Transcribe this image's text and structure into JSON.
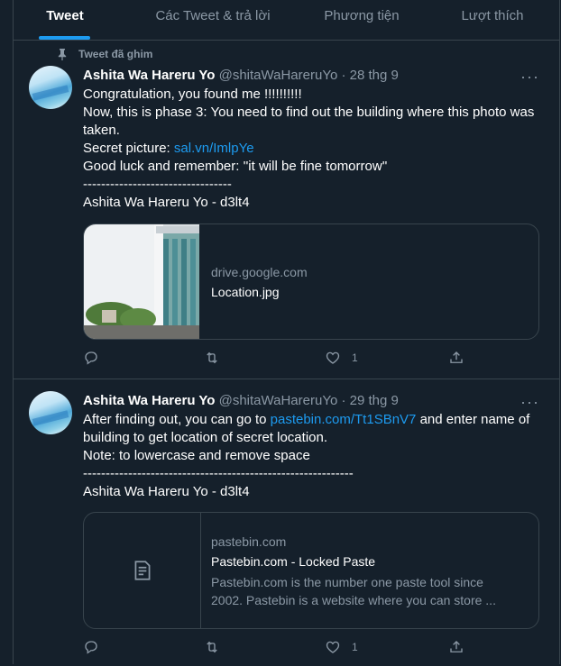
{
  "tabs": [
    {
      "label": "Tweet",
      "active": true
    },
    {
      "label": "Các Tweet & trả lời",
      "active": false
    },
    {
      "label": "Phương tiện",
      "active": false
    },
    {
      "label": "Lượt thích",
      "active": false
    }
  ],
  "tweet1": {
    "pinned_label": "Tweet đã ghim",
    "display_name": "Ashita Wa Hareru Yo",
    "handle": "@shitaWaHareruYo",
    "separator": " · ",
    "date": "28 thg 9",
    "more": "···",
    "text": {
      "line1": "Congratulation, you found me !!!!!!!!!!",
      "line2": "Now, this is phase 3: You need to find out the building where this photo was taken.",
      "line3_prefix": "Secret picture: ",
      "line3_link": "sal.vn/ImlpYe",
      "line4": "Good luck and remember: ''it will be fine tomorrow''",
      "line5": "---------------------------------",
      "line6": "Ashita Wa Hareru Yo - d3lt4"
    },
    "card": {
      "domain": "drive.google.com",
      "title": "Location.jpg"
    },
    "actions": {
      "reply": "",
      "retweet": "",
      "like": "1",
      "share": ""
    }
  },
  "tweet2": {
    "display_name": "Ashita Wa Hareru Yo",
    "handle": "@shitaWaHareruYo",
    "separator": " · ",
    "date": "29 thg 9",
    "more": "···",
    "text": {
      "line1_prefix": "After finding out, you can go to ",
      "line1_link": "pastebin.com/Tt1SBnV7",
      "line1_suffix": " and enter name of building to get location of secret location.",
      "line2": "Note: to lowercase and remove space",
      "line3": "------------------------------------------------------------",
      "line4": "Ashita Wa Hareru Yo - d3lt4"
    },
    "card": {
      "domain": "pastebin.com",
      "title": "Pastebin.com - Locked Paste",
      "desc_line1": "Pastebin.com is the number one paste tool since",
      "desc_line2": "2002. Pastebin is a website where you can store ..."
    },
    "actions": {
      "reply": "",
      "retweet": "",
      "like": "1",
      "share": ""
    }
  },
  "colors": {
    "background": "#15202b",
    "accent": "#1d9bf0",
    "muted": "#8b98a5",
    "border": "#38444d"
  }
}
